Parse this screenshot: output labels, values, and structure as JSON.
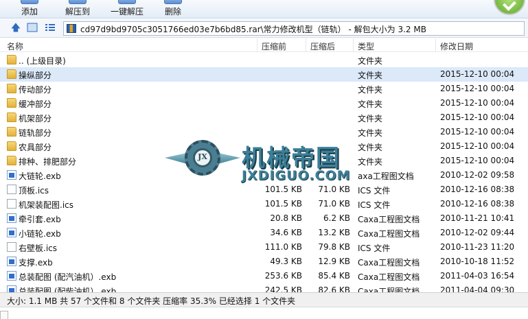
{
  "toolbar": {
    "buttons": [
      {
        "label": "添加",
        "icon": "add-icon"
      },
      {
        "label": "解压到",
        "icon": "extract-to-icon"
      },
      {
        "label": "一键解压",
        "icon": "one-click-extract-icon"
      },
      {
        "label": "删除",
        "icon": "delete-icon"
      }
    ],
    "shield_icon": "security-shield-icon"
  },
  "address_bar": {
    "path": "cd97d9bd9705c3051766ed03e7b6bd85.rar\\常力修改机型（链轨） - 解包大小为 3.2 MB"
  },
  "columns": {
    "name": "名称",
    "compressed": "压缩前",
    "packed": "压缩后",
    "type": "类型",
    "modified": "修改日期"
  },
  "files": [
    {
      "name": ".. (上级目录)",
      "size": "",
      "packed": "",
      "type": "文件夹",
      "date": "",
      "icon": "folder-icon"
    },
    {
      "name": "操纵部分",
      "size": "",
      "packed": "",
      "type": "文件夹",
      "date": "2015-12-10 00:04",
      "icon": "folder-icon"
    },
    {
      "name": "传动部分",
      "size": "",
      "packed": "",
      "type": "文件夹",
      "date": "2015-12-10 00:04",
      "icon": "folder-icon"
    },
    {
      "name": "缓冲部分",
      "size": "",
      "packed": "",
      "type": "文件夹",
      "date": "2015-12-10 00:04",
      "icon": "folder-icon"
    },
    {
      "name": "机架部分",
      "size": "",
      "packed": "",
      "type": "文件夹",
      "date": "2015-12-10 00:04",
      "icon": "folder-icon"
    },
    {
      "name": "链轨部分",
      "size": "",
      "packed": "",
      "type": "文件夹",
      "date": "2015-12-10 00:04",
      "icon": "folder-icon"
    },
    {
      "name": "农具部分",
      "size": "",
      "packed": "",
      "type": "文件夹",
      "date": "2015-12-10 00:04",
      "icon": "folder-icon"
    },
    {
      "name": "排种、排肥部分",
      "size": "",
      "packed": "",
      "type": "文件夹",
      "date": "2015-12-10 00:04",
      "icon": "folder-icon"
    },
    {
      "name": "大链轮.exb",
      "size": "",
      "packed": "",
      "type": "axa工程图文档",
      "date": "2010-12-02 09:58",
      "icon": "exb-file-icon"
    },
    {
      "name": "顶板.ics",
      "size": "101.5 KB",
      "packed": "71.0 KB",
      "type": "ICS 文件",
      "date": "2010-12-16 08:38",
      "icon": "ics-file-icon"
    },
    {
      "name": "机架装配图.ics",
      "size": "101.5 KB",
      "packed": "71.0 KB",
      "type": "ICS 文件",
      "date": "2010-12-16 08:38",
      "icon": "ics-file-icon"
    },
    {
      "name": "牵引套.exb",
      "size": "20.8 KB",
      "packed": "6.2 KB",
      "type": "Caxa工程图文档",
      "date": "2010-11-21 10:41",
      "icon": "exb-file-icon"
    },
    {
      "name": "小链轮.exb",
      "size": "34.6 KB",
      "packed": "13.2 KB",
      "type": "Caxa工程图文档",
      "date": "2010-12-02 09:44",
      "icon": "exb-file-icon"
    },
    {
      "name": "右壁板.ics",
      "size": "111.0 KB",
      "packed": "79.8 KB",
      "type": "ICS 文件",
      "date": "2010-11-23 11:20",
      "icon": "ics-file-icon"
    },
    {
      "name": "支撑.exb",
      "size": "49.3 KB",
      "packed": "12.9 KB",
      "type": "Caxa工程图文档",
      "date": "2010-10-18 11:52",
      "icon": "exb-file-icon"
    },
    {
      "name": "总装配图 (配汽油机）.exb",
      "size": "253.6 KB",
      "packed": "85.4 KB",
      "type": "Caxa工程图文档",
      "date": "2011-04-03 16:54",
      "icon": "exb-file-icon"
    },
    {
      "name": "总装配图 (配柴油机）.exb",
      "size": "242.5 KB",
      "packed": "82.6 KB",
      "type": "Caxa工程图文档",
      "date": "2011-04-04 09:30",
      "icon": "exb-file-icon"
    }
  ],
  "selected_index": 1,
  "watermark": {
    "title": "机械帝国",
    "site": "JXDIGUO.COM",
    "badge": "JX"
  },
  "status": {
    "text": "大小: 1.1 MB 共 57 个文件和 8 个文件夹 压缩率 35.3% 已经选择 1 个文件夹"
  },
  "colors": {
    "selection": "#dbe9f9",
    "watermark": "#3b7f98",
    "folder": "#e2b23b"
  }
}
